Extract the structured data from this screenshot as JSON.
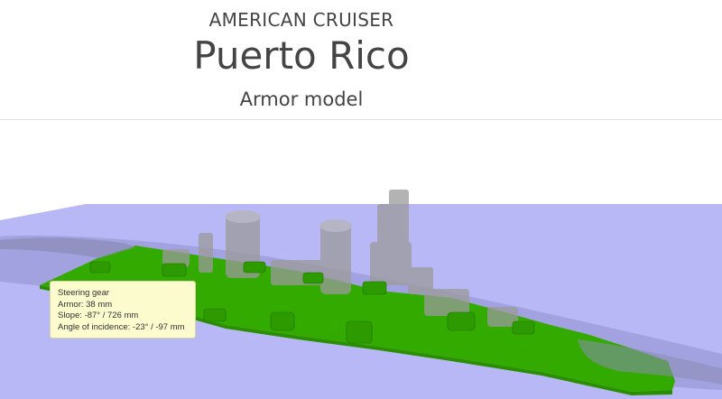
{
  "header": {
    "ship_class": "AMERICAN CRUISER",
    "ship_name": "Puerto Rico",
    "model_title": "Armor model"
  },
  "tooltip": {
    "part_name": "Steering gear",
    "armor": "Armor: 38 mm",
    "slope": "Slope: -87° / 726 mm",
    "angle": "Angle of incidence: -23° / -97 mm"
  },
  "colors": {
    "water_plane": "#b8b8f6",
    "armor_plate": "#33aa00",
    "ghost_structure": "#9a9a9a",
    "tooltip_bg": "#fbfbce"
  }
}
